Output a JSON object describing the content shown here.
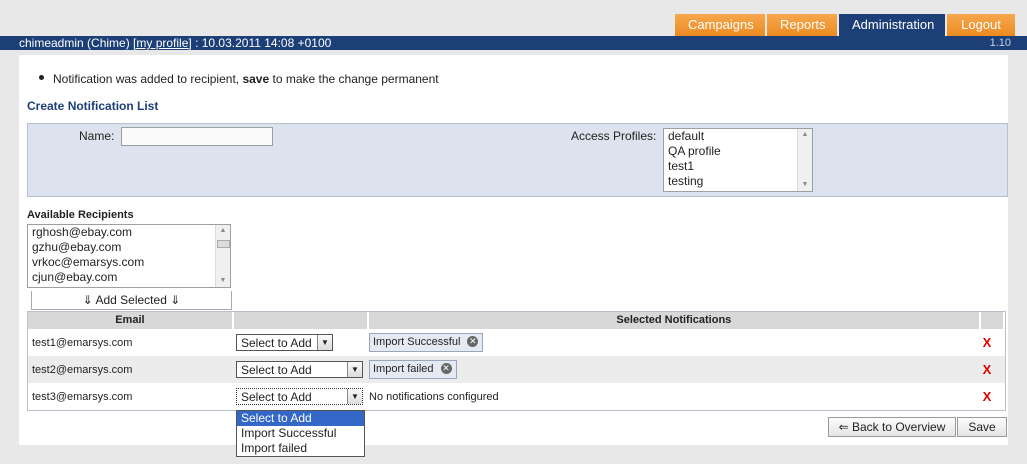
{
  "nav": {
    "tabs": [
      {
        "label": "Campaigns"
      },
      {
        "label": "Reports"
      },
      {
        "label": "Administration"
      },
      {
        "label": "Logout"
      }
    ]
  },
  "userbar": {
    "user": "chimeadmin (Chime)",
    "profile_link": "[my profile]",
    "datetime": ": 10.03.2011 14:08 +0100",
    "version": "1.10"
  },
  "notice": {
    "prefix": "Notification was added to recipient, ",
    "bold": "save",
    "suffix": " to make the change permanent"
  },
  "section_title": "Create Notification List",
  "form": {
    "name_label": "Name:",
    "name_value": "",
    "access_profiles_label": "Access Profiles:",
    "access_profiles": [
      "default",
      "QA profile",
      "test1",
      "testing"
    ]
  },
  "recipients": {
    "title": "Available Recipients",
    "items": [
      "rghosh@ebay.com",
      "gzhu@ebay.com",
      "vrkoc@emarsys.com",
      "cjun@ebay.com"
    ],
    "add_button": "⇓ Add Selected ⇓"
  },
  "table": {
    "headers": {
      "email": "Email",
      "select": "",
      "notifications": "Selected Notifications",
      "delete": ""
    },
    "rows": [
      {
        "email": "test1@emarsys.com",
        "select": "Select to Add",
        "notifications": [
          "Import Successful"
        ],
        "delete": "X"
      },
      {
        "email": "test2@emarsys.com",
        "select": "Select to Add",
        "notifications": [
          "Import failed"
        ],
        "delete": "X"
      },
      {
        "email": "test3@emarsys.com",
        "select": "Select to Add",
        "notifications_empty": "No notifications configured",
        "delete": "X"
      }
    ]
  },
  "dropdown_options": [
    "Select to Add",
    "Import Successful",
    "Import failed"
  ],
  "buttons": {
    "back": "⇐ Back to Overview",
    "save": "Save"
  },
  "colors": {
    "nav_blue": "#1c3f78",
    "tab_orange": "#ec8a20",
    "delete_red": "#dd0000"
  }
}
